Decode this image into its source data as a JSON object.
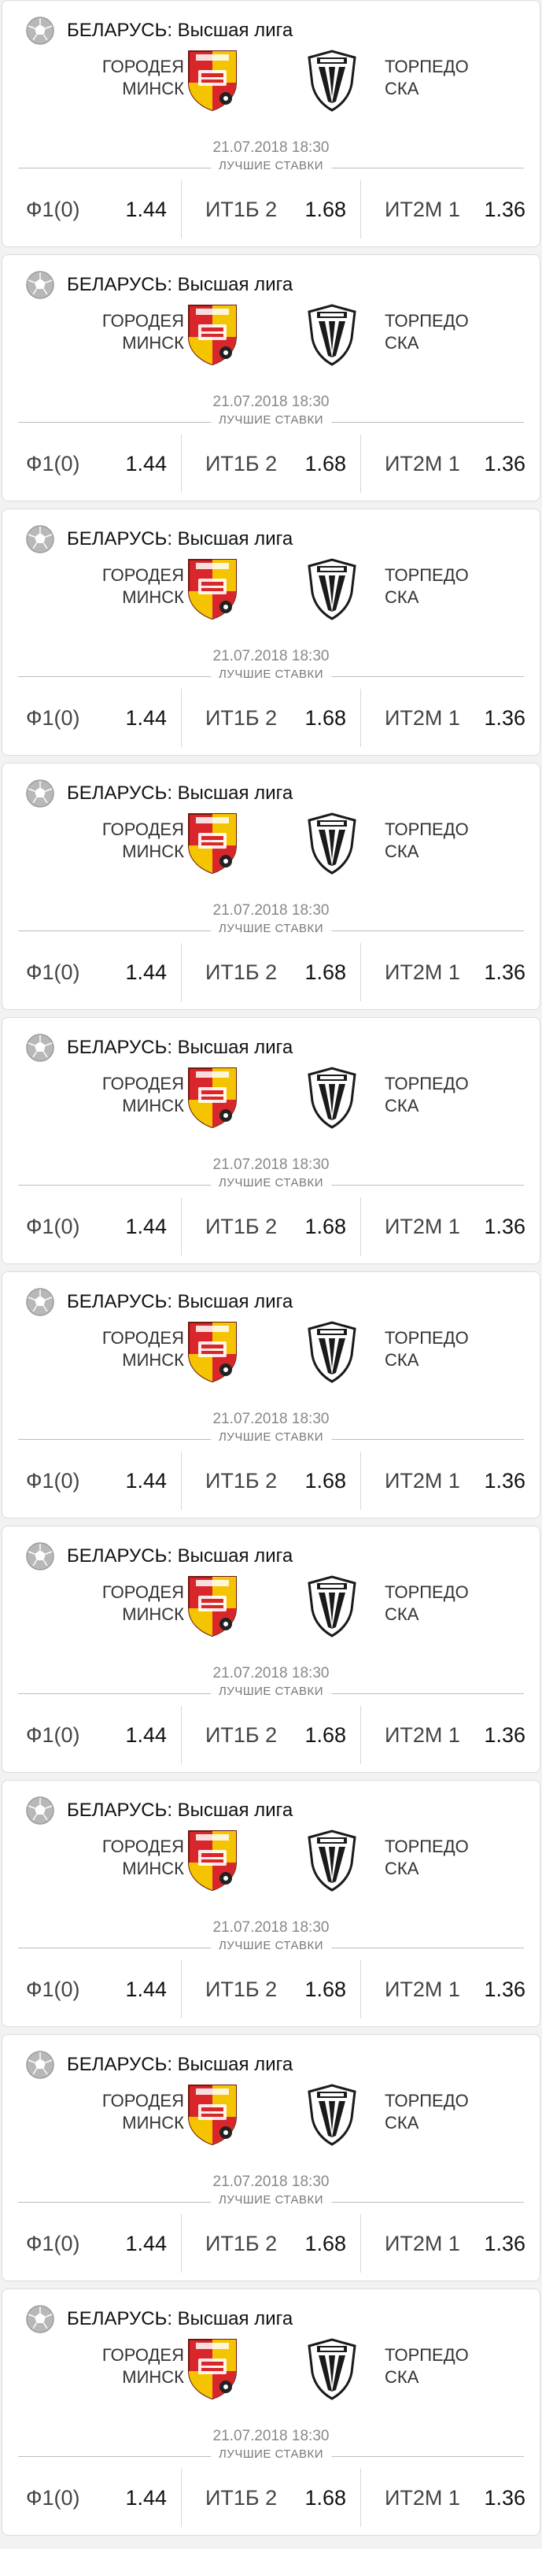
{
  "matches": [
    {
      "league": "БЕЛАРУСЬ: Высшая лига",
      "home": [
        "ГОРОДЕЯ",
        "МИНСК"
      ],
      "away": [
        "ТОРПЕДО",
        "СКА"
      ],
      "date": "21.07.2018 18:30",
      "best_label": "ЛУЧШИЕ СТАВКИ",
      "odds": [
        {
          "name": "Ф1(0)",
          "value": "1.44"
        },
        {
          "name": "ИТ1Б 2",
          "value": "1.68"
        },
        {
          "name": "ИТ2М 1",
          "value": "1.36"
        }
      ]
    },
    {
      "league": "БЕЛАРУСЬ: Высшая лига",
      "home": [
        "ГОРОДЕЯ",
        "МИНСК"
      ],
      "away": [
        "ТОРПЕДО",
        "СКА"
      ],
      "date": "21.07.2018 18:30",
      "best_label": "ЛУЧШИЕ СТАВКИ",
      "odds": [
        {
          "name": "Ф1(0)",
          "value": "1.44"
        },
        {
          "name": "ИТ1Б 2",
          "value": "1.68"
        },
        {
          "name": "ИТ2М 1",
          "value": "1.36"
        }
      ]
    },
    {
      "league": "БЕЛАРУСЬ: Высшая лига",
      "home": [
        "ГОРОДЕЯ",
        "МИНСК"
      ],
      "away": [
        "ТОРПЕДО",
        "СКА"
      ],
      "date": "21.07.2018 18:30",
      "best_label": "ЛУЧШИЕ СТАВКИ",
      "odds": [
        {
          "name": "Ф1(0)",
          "value": "1.44"
        },
        {
          "name": "ИТ1Б 2",
          "value": "1.68"
        },
        {
          "name": "ИТ2М 1",
          "value": "1.36"
        }
      ]
    },
    {
      "league": "БЕЛАРУСЬ: Высшая лига",
      "home": [
        "ГОРОДЕЯ",
        "МИНСК"
      ],
      "away": [
        "ТОРПЕДО",
        "СКА"
      ],
      "date": "21.07.2018 18:30",
      "best_label": "ЛУЧШИЕ СТАВКИ",
      "odds": [
        {
          "name": "Ф1(0)",
          "value": "1.44"
        },
        {
          "name": "ИТ1Б 2",
          "value": "1.68"
        },
        {
          "name": "ИТ2М 1",
          "value": "1.36"
        }
      ]
    },
    {
      "league": "БЕЛАРУСЬ: Высшая лига",
      "home": [
        "ГОРОДЕЯ",
        "МИНСК"
      ],
      "away": [
        "ТОРПЕДО",
        "СКА"
      ],
      "date": "21.07.2018 18:30",
      "best_label": "ЛУЧШИЕ СТАВКИ",
      "odds": [
        {
          "name": "Ф1(0)",
          "value": "1.44"
        },
        {
          "name": "ИТ1Б 2",
          "value": "1.68"
        },
        {
          "name": "ИТ2М 1",
          "value": "1.36"
        }
      ]
    },
    {
      "league": "БЕЛАРУСЬ: Высшая лига",
      "home": [
        "ГОРОДЕЯ",
        "МИНСК"
      ],
      "away": [
        "ТОРПЕДО",
        "СКА"
      ],
      "date": "21.07.2018 18:30",
      "best_label": "ЛУЧШИЕ СТАВКИ",
      "odds": [
        {
          "name": "Ф1(0)",
          "value": "1.44"
        },
        {
          "name": "ИТ1Б 2",
          "value": "1.68"
        },
        {
          "name": "ИТ2М 1",
          "value": "1.36"
        }
      ]
    },
    {
      "league": "БЕЛАРУСЬ: Высшая лига",
      "home": [
        "ГОРОДЕЯ",
        "МИНСК"
      ],
      "away": [
        "ТОРПЕДО",
        "СКА"
      ],
      "date": "21.07.2018 18:30",
      "best_label": "ЛУЧШИЕ СТАВКИ",
      "odds": [
        {
          "name": "Ф1(0)",
          "value": "1.44"
        },
        {
          "name": "ИТ1Б 2",
          "value": "1.68"
        },
        {
          "name": "ИТ2М 1",
          "value": "1.36"
        }
      ]
    },
    {
      "league": "БЕЛАРУСЬ: Высшая лига",
      "home": [
        "ГОРОДЕЯ",
        "МИНСК"
      ],
      "away": [
        "ТОРПЕДО",
        "СКА"
      ],
      "date": "21.07.2018 18:30",
      "best_label": "ЛУЧШИЕ СТАВКИ",
      "odds": [
        {
          "name": "Ф1(0)",
          "value": "1.44"
        },
        {
          "name": "ИТ1Б 2",
          "value": "1.68"
        },
        {
          "name": "ИТ2М 1",
          "value": "1.36"
        }
      ]
    },
    {
      "league": "БЕЛАРУСЬ: Высшая лига",
      "home": [
        "ГОРОДЕЯ",
        "МИНСК"
      ],
      "away": [
        "ТОРПЕДО",
        "СКА"
      ],
      "date": "21.07.2018 18:30",
      "best_label": "ЛУЧШИЕ СТАВКИ",
      "odds": [
        {
          "name": "Ф1(0)",
          "value": "1.44"
        },
        {
          "name": "ИТ1Б 2",
          "value": "1.68"
        },
        {
          "name": "ИТ2М 1",
          "value": "1.36"
        }
      ]
    },
    {
      "league": "БЕЛАРУСЬ: Высшая лига",
      "home": [
        "ГОРОДЕЯ",
        "МИНСК"
      ],
      "away": [
        "ТОРПЕДО",
        "СКА"
      ],
      "date": "21.07.2018 18:30",
      "best_label": "ЛУЧШИЕ СТАВКИ",
      "odds": [
        {
          "name": "Ф1(0)",
          "value": "1.44"
        },
        {
          "name": "ИТ1Б 2",
          "value": "1.68"
        },
        {
          "name": "ИТ2М 1",
          "value": "1.36"
        }
      ]
    }
  ],
  "icons": {
    "league": "soccer-ball-icon",
    "home_logo": "fc-gorodeya-crest",
    "away_logo": "torpedo-ska-crest"
  },
  "colors": {
    "home_logo_red": "#d8262b",
    "home_logo_yellow": "#f5c400",
    "away_logo_black": "#1a1a1a",
    "league_icon": "#a8a8a8"
  }
}
